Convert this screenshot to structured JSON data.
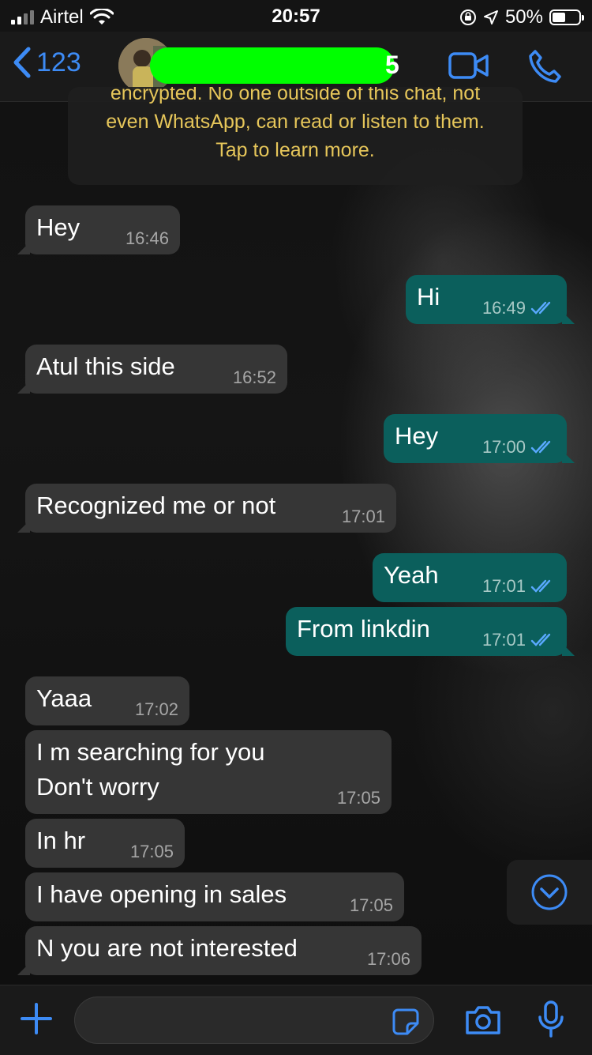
{
  "status_bar": {
    "carrier": "Airtel",
    "time": "20:57",
    "battery_percent": "50%"
  },
  "nav": {
    "back_count": "123",
    "contact_name_visible_tail": "5",
    "icons": [
      "chevron-left-icon",
      "video-call-icon",
      "phone-icon"
    ]
  },
  "notice": {
    "line1": "encrypted. No one outside of this chat, not",
    "line2": "even WhatsApp, can read or listen to them.",
    "line3": "Tap to learn more."
  },
  "messages": [
    {
      "dir": "in",
      "text": "Hey",
      "time": "16:46"
    },
    {
      "dir": "out",
      "text": "Hi",
      "time": "16:49",
      "read": true
    },
    {
      "dir": "in",
      "text": "Atul this side",
      "time": "16:52"
    },
    {
      "dir": "out",
      "text": "Hey",
      "time": "17:00",
      "read": true
    },
    {
      "dir": "in",
      "text": "Recognized me or not",
      "time": "17:01"
    },
    {
      "dir": "out",
      "text": "Yeah",
      "time": "17:01",
      "read": true
    },
    {
      "dir": "out",
      "text": "From linkdin",
      "time": "17:01",
      "read": true
    },
    {
      "dir": "in",
      "text": "Yaaa",
      "time": "17:02"
    },
    {
      "dir": "in",
      "text": "I m searching for you",
      "text2": "Don't worry",
      "time": "17:05"
    },
    {
      "dir": "in",
      "text": "In hr",
      "time": "17:05"
    },
    {
      "dir": "in",
      "text": "I have opening in sales",
      "time": "17:05"
    },
    {
      "dir": "in",
      "text": "N you are not interested",
      "time": "17:06"
    }
  ],
  "composer": {
    "value": "",
    "icons": [
      "plus-icon",
      "sticker-icon",
      "camera-icon",
      "microphone-icon"
    ]
  },
  "colors": {
    "accent": "#3d8bf5",
    "incoming_bubble": "#363636",
    "outgoing_bubble": "#0b5f5c",
    "notice_text": "#e6c65a",
    "read_ticks": "#5aa9ff"
  }
}
